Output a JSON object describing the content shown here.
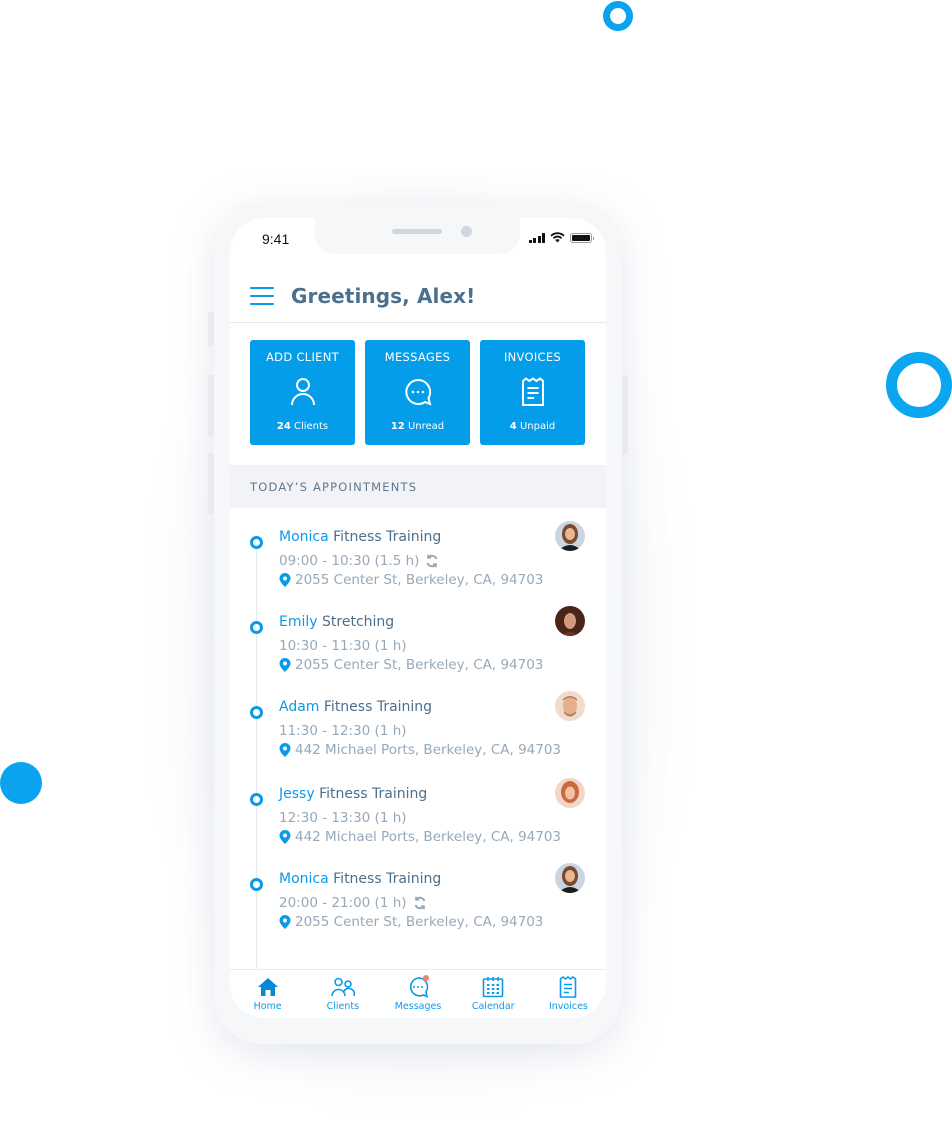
{
  "status_bar": {
    "time": "9:41"
  },
  "header": {
    "title": "Greetings, Alex!"
  },
  "tiles": [
    {
      "label": "ADD CLIENT",
      "icon": "person-icon",
      "count": "24",
      "count_label": "Clients"
    },
    {
      "label": "MESSAGES",
      "icon": "chat-bubble-icon",
      "count": "12",
      "count_label": "Unread"
    },
    {
      "label": "INVOICES",
      "icon": "receipt-icon",
      "count": "4",
      "count_label": "Unpaid"
    }
  ],
  "section": {
    "title": "TODAY’S APPOINTMENTS"
  },
  "appointments": [
    {
      "name": "Monica",
      "service": "Fitness Training",
      "time": "09:00 - 10:30 (1.5 h)",
      "recurring": true,
      "address": "2055 Center St, Berkeley, CA, 94703"
    },
    {
      "name": "Emily",
      "service": "Stretching",
      "time": "10:30 - 11:30 (1 h)",
      "recurring": false,
      "address": "2055 Center St, Berkeley, CA, 94703"
    },
    {
      "name": "Adam",
      "service": "Fitness Training",
      "time": "11:30 - 12:30 (1 h)",
      "recurring": false,
      "address": "442 Michael Ports, Berkeley, CA, 94703"
    },
    {
      "name": "Jessy",
      "service": "Fitness Training",
      "time": "12:30 - 13:30 (1 h)",
      "recurring": false,
      "address": "442 Michael Ports, Berkeley, CA, 94703"
    },
    {
      "name": "Monica",
      "service": "Fitness Training",
      "time": "20:00 - 21:00 (1 h)",
      "recurring": true,
      "address": "2055 Center St, Berkeley, CA, 94703"
    }
  ],
  "tabbar": [
    {
      "label": "Home",
      "icon": "home-icon",
      "active": true
    },
    {
      "label": "Clients",
      "icon": "clients-icon"
    },
    {
      "label": "Messages",
      "icon": "messages-icon",
      "has_badge": true
    },
    {
      "label": "Calendar",
      "icon": "calendar-icon"
    },
    {
      "label": "Invoices",
      "icon": "invoices-icon"
    }
  ],
  "colors": {
    "accent": "#0a9be8",
    "tile_bg": "#049de9",
    "title_text": "#4c6f8c",
    "muted_text": "#97a9b9",
    "badge": "#f5826d",
    "section_bg": "#f2f3f6"
  }
}
